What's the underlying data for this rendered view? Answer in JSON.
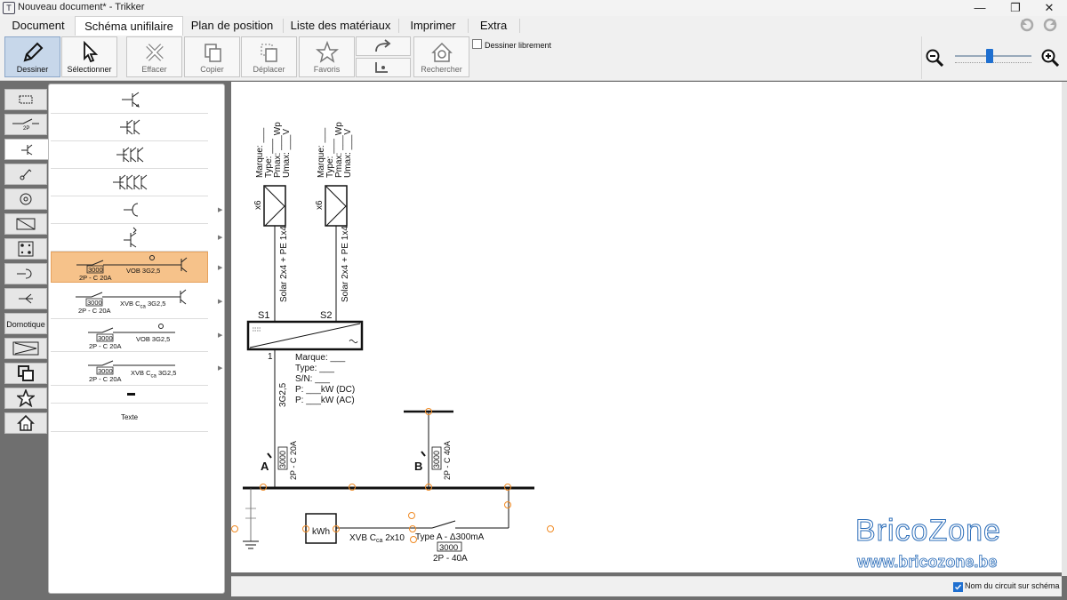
{
  "window": {
    "title": "Nouveau document* - Trikker",
    "app_icon": "T",
    "controls": [
      "minimize-icon",
      "restore-icon",
      "close-icon"
    ]
  },
  "tabs": [
    {
      "label": "Document",
      "active": false
    },
    {
      "label": "Schéma unifilaire",
      "active": true
    },
    {
      "label": "Plan de position",
      "active": false
    },
    {
      "label": "Liste des matériaux",
      "active": false
    },
    {
      "label": "Imprimer",
      "active": false
    },
    {
      "label": "Extra",
      "active": false
    }
  ],
  "toolbar": {
    "draw_label": "Dessiner",
    "select_label": "Sélectionner",
    "erase_label": "Effacer",
    "copy_label": "Copier",
    "move_label": "Déplacer",
    "favorites_label": "Favoris",
    "search_label": "Rechercher",
    "free_draw_label": "Dessiner librement",
    "free_draw_checked": false,
    "zoom_level": 0.45
  },
  "left_tabs": {
    "domotique_label": "Domotique",
    "switch_2p_label": "2P"
  },
  "palette": {
    "item_cb1": {
      "rating": "3000",
      "breaker": "2P - C 20A",
      "cable": "VOB 3G2,5"
    },
    "item_cb2": {
      "rating": "3000",
      "breaker": "2P - C 20A",
      "cable_prefix": "XVB C",
      "cable_sub": "ca",
      "cable_suffix": " 3G2,5"
    },
    "item_cb3": {
      "rating": "3000",
      "breaker": "2P - C 20A",
      "cable": "VOB 3G2,5"
    },
    "item_cb4": {
      "rating": "3000",
      "breaker": "2P - C 20A",
      "cable_prefix": "XVB C",
      "cable_sub": "ca",
      "cable_suffix": " 3G2,5"
    },
    "text_item": "Texte"
  },
  "schema": {
    "panel_labels": [
      "Marque: ___",
      "Type: ___",
      "Pmax: ___Wp",
      "Umax: ___V"
    ],
    "panel_count": "x6",
    "string_cable": "Solar 2x4 + PE 1x4",
    "string_s1": "S1",
    "string_s2": "S2",
    "inverter_terminal": "1",
    "inverter_info": [
      "Marque: ___",
      "Type: ___",
      "S/N: ___",
      "P: ___kW (DC)",
      "P: ___kW (AC)"
    ],
    "inverter_cable": "3G2,5",
    "circuit_a": {
      "name": "A",
      "rating": "3000",
      "breaker": "2P - C 20A"
    },
    "circuit_b": {
      "name": "B",
      "rating": "3000",
      "breaker": "2P - C 40A"
    },
    "meter_label": "kWh",
    "main_cable_prefix": "XVB C",
    "main_cable_sub": "ca",
    "main_cable_suffix": " 2x10",
    "rcd_type": "Type A - Δ300mA",
    "rcd_rating": "3000",
    "rcd_breaker": "2P - 40A"
  },
  "watermark": {
    "brand": "BricoZone",
    "url": "www.bricozone.be"
  },
  "status": {
    "show_circuit_name_label": "Nom du circuit sur schéma",
    "show_circuit_name_checked": true
  },
  "colors": {
    "accent": "#1e6fd0",
    "selection": "#f6c28a",
    "handle": "#f08a24"
  }
}
